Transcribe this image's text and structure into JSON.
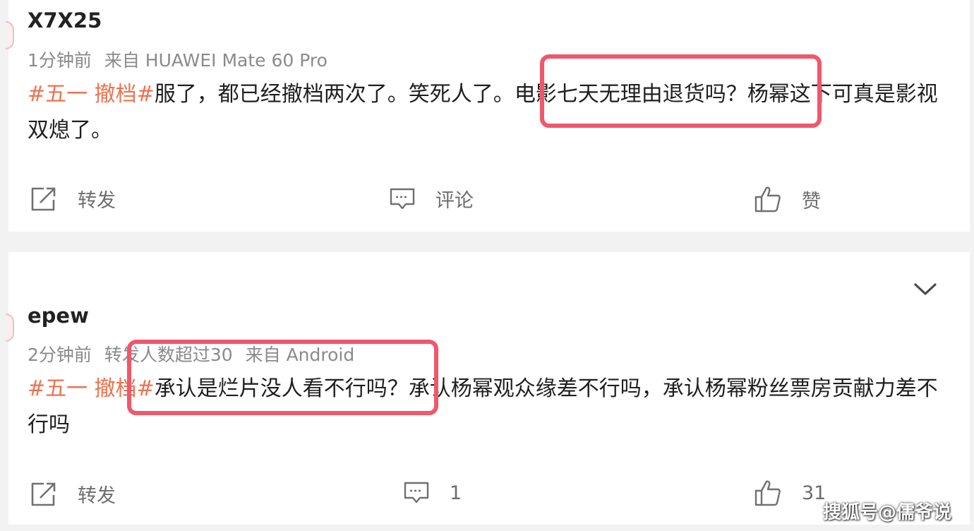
{
  "posts": [
    {
      "username": "X7X25",
      "time": "1分钟前",
      "source": "来自 HUAWEI Mate 60 Pro",
      "hashtag": "#五一 撤档#",
      "text_before": "服了，都已经撤档两次了。笑死人了。",
      "text_highlight": "电影七天无理由退货吗？",
      "text_after": "杨幂这下可真是影视双熄了。",
      "actions": {
        "repost_label": "转发",
        "comment_label": "评论",
        "like_label": "赞"
      }
    },
    {
      "username": "epew",
      "time": "2分钟前",
      "repost_note": "转发人数超过30",
      "source": "来自 Android",
      "hashtag": "#五一 撤档#",
      "text_highlight": "承认是烂片没人看不行吗？",
      "text_after": "承认杨幂观众缘差不行吗，承认杨幂粉丝票房贡献力差不行吗",
      "actions": {
        "repost_label": "转发",
        "comment_count": "1",
        "like_count": "31"
      }
    }
  ],
  "watermark": "搜狐号@儒爷说",
  "colors": {
    "hashtag": "#eb7350",
    "highlight_box": "#f0576b",
    "meta_text": "#8a8a8a",
    "action_text": "#6d6d6d"
  },
  "icons": [
    "repost-icon",
    "comment-icon",
    "like-icon",
    "chevron-down-icon"
  ]
}
